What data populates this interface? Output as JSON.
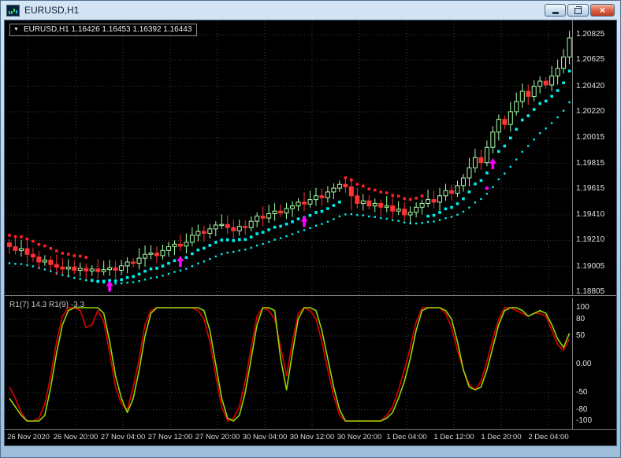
{
  "window": {
    "title": "EURUSD,H1",
    "controls": {
      "close_glyph": "×"
    }
  },
  "main_chart": {
    "label": {
      "triangle": "▼",
      "text": "EURUSD,H1 1.16426 1.16453 1.16392 1.16443"
    }
  },
  "indicator": {
    "label": "R1(7) 14.3  R1(9) -3.3",
    "axis": [
      "100",
      "80",
      "50",
      "0.00",
      "-50",
      "-80",
      "-100"
    ]
  },
  "chart_data": {
    "type": [
      "candlestick",
      "line"
    ],
    "symbol": "EURUSD",
    "timeframe": "H1",
    "main": {
      "type": "candlestick",
      "first_open": 1.1919,
      "closes": [
        1.1916,
        1.1913,
        1.19145,
        1.191,
        1.1908,
        1.1904,
        1.19055,
        1.1902,
        1.19,
        1.18985,
        1.19,
        1.18975,
        1.1899,
        1.1897,
        1.18985,
        1.18965,
        1.1898,
        1.18995,
        1.18975,
        1.1901,
        1.1904,
        1.1903,
        1.1907,
        1.191,
        1.1911,
        1.1909,
        1.1913,
        1.1916,
        1.1918,
        1.19165,
        1.19195,
        1.1925,
        1.1928,
        1.19265,
        1.193,
        1.1933,
        1.19335,
        1.1931,
        1.19285,
        1.1932,
        1.1931,
        1.1936,
        1.194,
        1.19385,
        1.1942,
        1.1944,
        1.19425,
        1.1946,
        1.1948,
        1.1951,
        1.19495,
        1.1953,
        1.1956,
        1.19545,
        1.1959,
        1.1962,
        1.1965,
        1.1963,
        1.1956,
        1.195,
        1.1952,
        1.1948,
        1.195,
        1.1947,
        1.1948,
        1.1944,
        1.19455,
        1.1941,
        1.1943,
        1.1947,
        1.195,
        1.1953,
        1.1951,
        1.1956,
        1.196,
        1.1958,
        1.1964,
        1.197,
        1.1978,
        1.1986,
        1.1982,
        1.1994,
        1.2006,
        1.2016,
        1.2012,
        1.2022,
        1.203,
        1.2038,
        1.2034,
        1.2042,
        1.2046,
        1.2043,
        1.205,
        1.2056,
        1.2065,
        1.208
      ],
      "wick_overrides": {
        "57": {
          "high": 1.197
        },
        "58": {
          "low": 1.19445
        }
      },
      "price_axis": [
        "1.20825",
        "1.20625",
        "1.20420",
        "1.20220",
        "1.20015",
        "1.19815",
        "1.19615",
        "1.19410",
        "1.19210",
        "1.19005",
        "1.18805"
      ],
      "trend_segments": [
        {
          "start": 0,
          "end": 13,
          "dir": "down"
        },
        {
          "start": 14,
          "end": 56,
          "dir": "up"
        },
        {
          "start": 57,
          "end": 70,
          "dir": "down"
        },
        {
          "start": 71,
          "end": 95,
          "dir": "up"
        }
      ],
      "buy_arrows_bars": [
        17,
        29,
        50,
        82
      ],
      "dot_marker": {
        "bar": 81,
        "price": 1.1962
      },
      "colors": {
        "bull": "#A8FFA8",
        "bear": "#FF3232",
        "trend_up": "#00F0F0",
        "trend_down": "#FF2020",
        "signal": "#FF00FF",
        "grid": "#3f3f3f"
      }
    },
    "oscillator": {
      "type": "line",
      "title": "R1",
      "range": [
        -100,
        100
      ],
      "levels": [
        80,
        50,
        0,
        -50,
        -80
      ],
      "series": [
        {
          "name": "R1(7)",
          "value_label": "14.3",
          "color": "#E00000",
          "values": [
            -40,
            -60,
            -85,
            -100,
            -100,
            -95,
            -70,
            -20,
            40,
            85,
            100,
            100,
            95,
            65,
            70,
            95,
            75,
            20,
            -40,
            -70,
            -80,
            -40,
            10,
            70,
            95,
            100,
            100,
            100,
            100,
            100,
            100,
            100,
            95,
            80,
            40,
            -20,
            -75,
            -100,
            -95,
            -75,
            -30,
            30,
            85,
            100,
            95,
            80,
            30,
            -20,
            40,
            90,
            100,
            95,
            80,
            40,
            -10,
            -55,
            -90,
            -100,
            -100,
            -100,
            -100,
            -100,
            -100,
            -100,
            -90,
            -75,
            -45,
            -10,
            30,
            75,
            100,
            100,
            100,
            100,
            90,
            65,
            25,
            -10,
            -35,
            -45,
            -30,
            5,
            45,
            80,
            100,
            100,
            95,
            90,
            85,
            90,
            90,
            85,
            60,
            35,
            25,
            45
          ]
        },
        {
          "name": "R1(9)",
          "value_label": "-3.3",
          "color": "#96D600",
          "values": [
            -60,
            -75,
            -90,
            -100,
            -100,
            -100,
            -90,
            -40,
            20,
            70,
            95,
            100,
            100,
            100,
            100,
            100,
            90,
            40,
            -20,
            -60,
            -85,
            -60,
            -10,
            50,
            90,
            100,
            100,
            100,
            100,
            100,
            100,
            100,
            100,
            95,
            60,
            0,
            -60,
            -95,
            -100,
            -90,
            -50,
            10,
            70,
            100,
            100,
            95,
            10,
            -45,
            20,
            80,
            100,
            100,
            95,
            60,
            10,
            -40,
            -80,
            -100,
            -100,
            -100,
            -100,
            -100,
            -100,
            -100,
            -95,
            -85,
            -60,
            -30,
            10,
            60,
            95,
            100,
            100,
            100,
            95,
            80,
            40,
            -10,
            -40,
            -45,
            -40,
            -10,
            30,
            70,
            95,
            100,
            100,
            95,
            85,
            90,
            95,
            90,
            70,
            45,
            30,
            55
          ]
        }
      ]
    },
    "x_labels": [
      "26 Nov 2020",
      "26 Nov 20:00",
      "27 Nov 04:00",
      "27 Nov 12:00",
      "27 Nov 20:00",
      "30 Nov 04:00",
      "30 Nov 12:00",
      "30 Nov 20:00",
      "1 Dec 04:00",
      "1 Dec 12:00",
      "1 Dec 20:00",
      "2 Dec 04:00"
    ]
  }
}
